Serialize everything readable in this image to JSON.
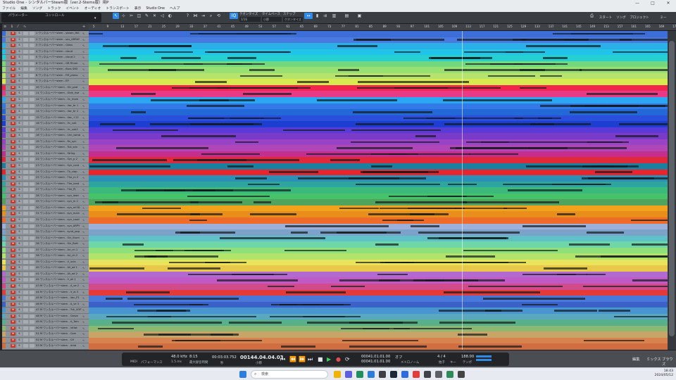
{
  "app": {
    "title": "Studio One - シンタルバーSteam版（ver.2-Stems版）用P",
    "window_controls": [
      "—",
      "□",
      "✕"
    ]
  },
  "menu": [
    "ファイル",
    "編集",
    "ソング",
    "トラック",
    "イベント",
    "オーディオ",
    "トランスポート",
    "表示",
    "Studio One",
    "ヘルプ"
  ],
  "toolbar": {
    "preset_label": "パラメーター",
    "preset2_label": "コントロール",
    "quantize_label": "クオンタイズ",
    "timebase_label": "タイムベース",
    "snap_label": "スナップ",
    "quantize_value": "1/16",
    "timebase_value": "小節",
    "snap_value": "クオンタイズ",
    "right_buttons": [
      "スタート",
      "ソング",
      "プロジェクト"
    ]
  },
  "ruler": {
    "ticks": [
      "5",
      "9",
      "13",
      "17",
      "21",
      "25",
      "29",
      "33",
      "37",
      "41",
      "45",
      "49",
      "53",
      "57",
      "61",
      "65",
      "69",
      "73",
      "77",
      "81",
      "85",
      "89",
      "93",
      "97",
      "101",
      "105",
      "109",
      "113",
      "117",
      "121",
      "125",
      "129",
      "133",
      "137",
      "141",
      "145",
      "149",
      "153",
      "157",
      "161",
      "165",
      "169",
      "173"
    ]
  },
  "tracks": [
    {
      "name": "1 ワンネルーバーstem - steam_INS",
      "color": "#3d6dd6"
    },
    {
      "name": "2 ワンネルーバーstem - sus_ARRAY",
      "color": "#4a7ae0"
    },
    {
      "name": "3 ワンネルーバーstem - Glass",
      "color": "#2ab0e6"
    },
    {
      "name": "4 ワンネルーバーstem - cloud",
      "color": "#21c4e8"
    },
    {
      "name": "5 ワンネルーバーstem - cloud 2",
      "color": "#26cfd4"
    },
    {
      "name": "6 ワンネルーバーstem - GB Rhum",
      "color": "#73d87c"
    },
    {
      "name": "7 ワンネルーバーstem - Bass SN5",
      "color": "#98e072"
    },
    {
      "name": "8 ワンネルーバーstem - FM_piano",
      "color": "#b6e36c"
    },
    {
      "name": "9 ワンネルーバーstem - EP",
      "color": "#d7ea4f"
    },
    {
      "name": "10 ワンネルーバーstem - Gtr_pad",
      "color": "#f2264d"
    },
    {
      "name": "11 ワンネルーバーstem - Glok_rise",
      "color": "#e93a88"
    },
    {
      "name": "12 ワンネルーバーstem - Vc_main",
      "color": "#2aa6f2"
    },
    {
      "name": "13 ワンネルーバーstem - Voc_br 1",
      "color": "#3479e8"
    },
    {
      "name": "14 ワンネルーバーstem - Voc_br 2",
      "color": "#2268d6"
    },
    {
      "name": "15 ワンネルーバーstem - Voc_+12",
      "color": "#2a4fdc"
    },
    {
      "name": "16 ワンネルーバーstem - Vc_sub",
      "color": "#1d3fd1"
    },
    {
      "name": "17 ワンネルーバーstem - Vc_sub2",
      "color": "#5a3bd8"
    },
    {
      "name": "18 ワンネルーバーstem - Chk_tamb",
      "color": "#7a3bc8"
    },
    {
      "name": "19 ワンネルーバーstem - Rv_syn",
      "color": "#9944c7"
    },
    {
      "name": "20 ワンネルーバーstem - Tuk_sdx",
      "color": "#b047b8"
    },
    {
      "name": "21 ワンネルーバーstem - String",
      "color": "#c42f8f"
    },
    {
      "name": "22 ワンネルーバーstem - Syn_p 2",
      "color": "#e02a3a"
    },
    {
      "name": "23 ワンネルーバーstem - Syn_cord",
      "color": "#1b7fa0"
    },
    {
      "name": "24 ワンネルーバーstem - Th_clap",
      "color": "#e8252c"
    },
    {
      "name": "25 ワンネルーバーstem - The_m 2",
      "color": "#2b8fb6"
    },
    {
      "name": "26 ワンネルーバーstem - The_lead",
      "color": "#2ea59e"
    },
    {
      "name": "27 ワンネルーバーstem - The_PJ",
      "color": "#3bb87b"
    },
    {
      "name": "28 ワンネルーバーstem - syn_lead",
      "color": "#46c26a"
    },
    {
      "name": "29 ワンネルーバーstem - syn_m 2",
      "color": "#4fa35c"
    },
    {
      "name": "30 ワンネルーバーstem - syn_mi3D",
      "color": "#f2a21b"
    },
    {
      "name": "31 ワンネルーバーstem - syn_main",
      "color": "#e88e1a"
    },
    {
      "name": "32 ワンネルーバーstem - syn_Lead",
      "color": "#ef6b2a"
    },
    {
      "name": "33 ワンネルーバーstem - syn_ARPY",
      "color": "#9cb1d9"
    },
    {
      "name": "34 ワンネルーバーstem - synd_pop",
      "color": "#7da2c9"
    },
    {
      "name": "35 ワンネルーバーstem - Gtr_Stum",
      "color": "#5fc0c8"
    },
    {
      "name": "36 ワンネルーバーstem - Gtr_Butt",
      "color": "#6fd6a8"
    },
    {
      "name": "37 ワンネルーバーstem - Ari_ch 1",
      "color": "#8fe07a"
    },
    {
      "name": "38 ワンネルーバーstem - Ari_ch 2",
      "color": "#b2e36b"
    },
    {
      "name": "39 ワンネルーバーstem - V_ucla",
      "color": "#e8e35a"
    },
    {
      "name": "40 ワンネルーバーstem - Ali_ad 1",
      "color": "#e8c848"
    },
    {
      "name": "41 ワンネルーバーstem - Ali_ad 2",
      "color": "#b36ad0"
    },
    {
      "name": "42 ワンネルーバーstem - V_aii 1",
      "color": "#c05ac6"
    },
    {
      "name": "43 M ワンネルーバーstem - A_ve 2",
      "color": "#d14a8a"
    },
    {
      "name": "44 M ワンネルーバーstem - V_ai 3",
      "color": "#e43a3a"
    },
    {
      "name": "45 M ワンネルーバーstem - Voc_P1",
      "color": "#4a78d8"
    },
    {
      "name": "46 M ワンネルーバーstem - A_ve 3",
      "color": "#3a62c8"
    },
    {
      "name": "47 M ワンネルーバーstem - Tuk_VOP",
      "color": "#4895d0"
    },
    {
      "name": "48 M ワンネルーバーstem - Grove",
      "color": "#5aa8c0"
    },
    {
      "name": "49 M ワンネルーバーstem - A_Tom",
      "color": "#58b08a"
    },
    {
      "name": "50 M ワンネルーバーstem - inHat",
      "color": "#8cb872"
    },
    {
      "name": "51 M ワンネルーバーstem - Com",
      "color": "#c8a468"
    },
    {
      "name": "52 M ワンネルーバーstem - CH",
      "color": "#d8824e"
    },
    {
      "name": "53 M ワンネルーバーstem - Amb",
      "color": "#d06e42"
    }
  ],
  "transport": {
    "midi_label": "MIDI",
    "perf_label": "パフォーマンス",
    "sample_rate": "48.0 kHz",
    "latency": "1.5 ms",
    "bits": "8:15",
    "bits_label": "最大録音時間",
    "time_seconds": "00:03:03.752",
    "time_label": "秒",
    "bar_position": "00144.04.04.03",
    "bar_label": "小節",
    "loop_start": "00041.01.01.00",
    "loop_end": "00041.01.01.00",
    "meter": "4 / 4",
    "meter_label": "拍子",
    "tempo": "188.00",
    "tempo_label": "テンポ",
    "metronome_label": "メトロノーム",
    "key_label": "キー",
    "off_label": "オフ"
  },
  "right_panel": {
    "tabs": [
      "編集",
      "ミックス",
      "ブラウズ"
    ]
  },
  "taskbar": {
    "search_placeholder": "検索",
    "time": "18:43",
    "date": "2024/05/12"
  },
  "colors": {
    "accent": "#2f8be6",
    "mute": "#c0392b"
  }
}
